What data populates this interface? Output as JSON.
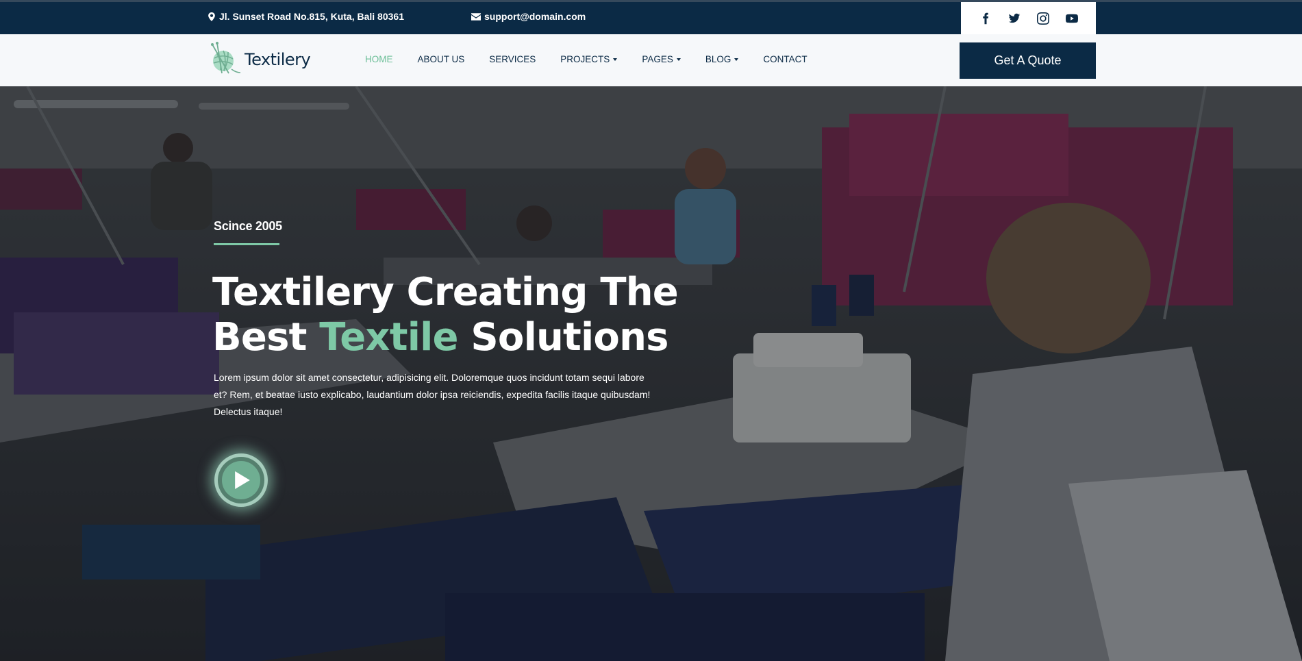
{
  "topbar": {
    "address": "Jl. Sunset Road No.815, Kuta, Bali 80361",
    "email": "support@domain.com",
    "social": [
      "facebook-icon",
      "twitter-icon",
      "instagram-icon",
      "youtube-icon"
    ]
  },
  "brand": {
    "name": "Textilery",
    "primary": "#0b2a45",
    "accent": "#7ec9a6"
  },
  "nav": {
    "items": [
      {
        "label": "HOME",
        "active": true,
        "dropdown": false
      },
      {
        "label": "ABOUT US",
        "active": false,
        "dropdown": false
      },
      {
        "label": "SERVICES",
        "active": false,
        "dropdown": false
      },
      {
        "label": "PROJECTS",
        "active": false,
        "dropdown": true
      },
      {
        "label": "PAGES",
        "active": false,
        "dropdown": true
      },
      {
        "label": "BLOG",
        "active": false,
        "dropdown": true
      },
      {
        "label": "CONTACT",
        "active": false,
        "dropdown": false
      }
    ],
    "cta": "Get A Quote"
  },
  "hero": {
    "since": "Scince 2005",
    "title_line1": "Textilery Creating The",
    "title_line2_start": "Best ",
    "title_line2_accent": "Textile",
    "title_line2_end": " Solutions",
    "lead": "Lorem ipsum dolor sit amet consectetur, adipisicing elit. Doloremque quos incidunt totam sequi labore et? Rem, et beatae iusto explicabo, laudantium dolor ipsa reiciendis, expedita facilis itaque quibusdam! Delectus itaque!"
  }
}
